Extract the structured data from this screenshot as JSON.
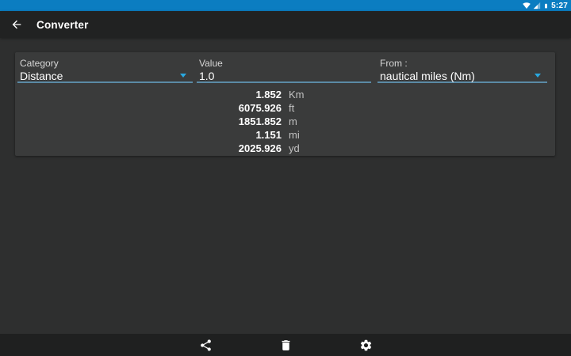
{
  "status_bar": {
    "time": "5:27"
  },
  "app_bar": {
    "title": "Converter"
  },
  "form": {
    "category": {
      "label": "Category",
      "value": "Distance"
    },
    "value": {
      "label": "Value",
      "value": "1.0"
    },
    "from": {
      "label": "From :",
      "value": "nautical miles (Nm)"
    }
  },
  "results": [
    {
      "value": "1.852",
      "unit": "Km"
    },
    {
      "value": "6075.926",
      "unit": "ft"
    },
    {
      "value": "1851.852",
      "unit": "m"
    },
    {
      "value": "1.151",
      "unit": "mi"
    },
    {
      "value": "2025.926",
      "unit": "yd"
    }
  ],
  "colors": {
    "status_bar": "#0b7dc1",
    "app_bar": "#212222",
    "background": "#2e2f2f",
    "card": "#3a3b3b",
    "field_underline": "#5a8aa5",
    "dropdown_arrow": "#29a8e0",
    "bottom_bar": "#1f2020",
    "text_primary": "#ffffff",
    "text_secondary": "#c2c2c2"
  }
}
